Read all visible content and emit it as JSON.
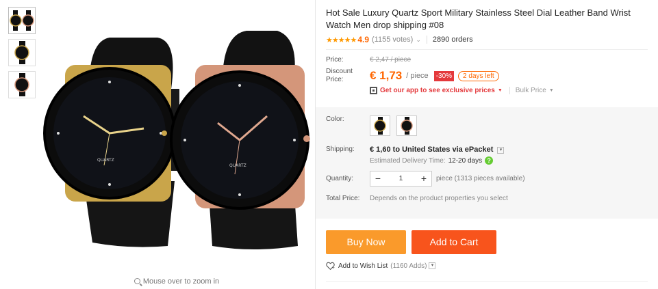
{
  "gallery": {
    "thumbnails": [
      "thumb-pair",
      "thumb-gold",
      "thumb-rose"
    ],
    "zoom_hint": "Mouse over to zoom in",
    "watch_label": "QUARTZ"
  },
  "product": {
    "title": "Hot Sale Luxury Quartz Sport Military Stainless Steel Dial Leather Band Wrist Watch Men drop shipping #08",
    "stars": "★★★★★",
    "rating": "4.9",
    "votes": "(1155 votes)",
    "orders": "2890 orders"
  },
  "pricing": {
    "price_label": "Price:",
    "original_price": "€ 2,47 / piece",
    "discount_label": "Discount Price:",
    "discount_price": "€ 1,73",
    "per_piece": "/ piece",
    "discount_badge": "-30%",
    "time_left": "2 days left",
    "app_promo": "Get our app to see exclusive prices",
    "bulk_price": "Bulk Price"
  },
  "options": {
    "color_label": "Color:",
    "shipping_label": "Shipping:",
    "shipping_cost": "€ 1,60",
    "shipping_to": "to United States via ePacket",
    "est_label": "Estimated Delivery Time:",
    "est_days": "12-20 days",
    "quantity_label": "Quantity:",
    "quantity_value": "1",
    "quantity_avail": "piece (1313 pieces available)",
    "total_label": "Total Price:",
    "total_value": "Depends on the product properties you select"
  },
  "actions": {
    "buy_now": "Buy Now",
    "add_to_cart": "Add to Cart",
    "wish_list": "Add to Wish List",
    "wish_count": "(1160 Adds)"
  },
  "colors": {
    "accent_orange": "#f60",
    "buy_now_bg": "#fa9a2b",
    "cart_bg": "#f8541c",
    "promo_red": "#e4393c"
  }
}
